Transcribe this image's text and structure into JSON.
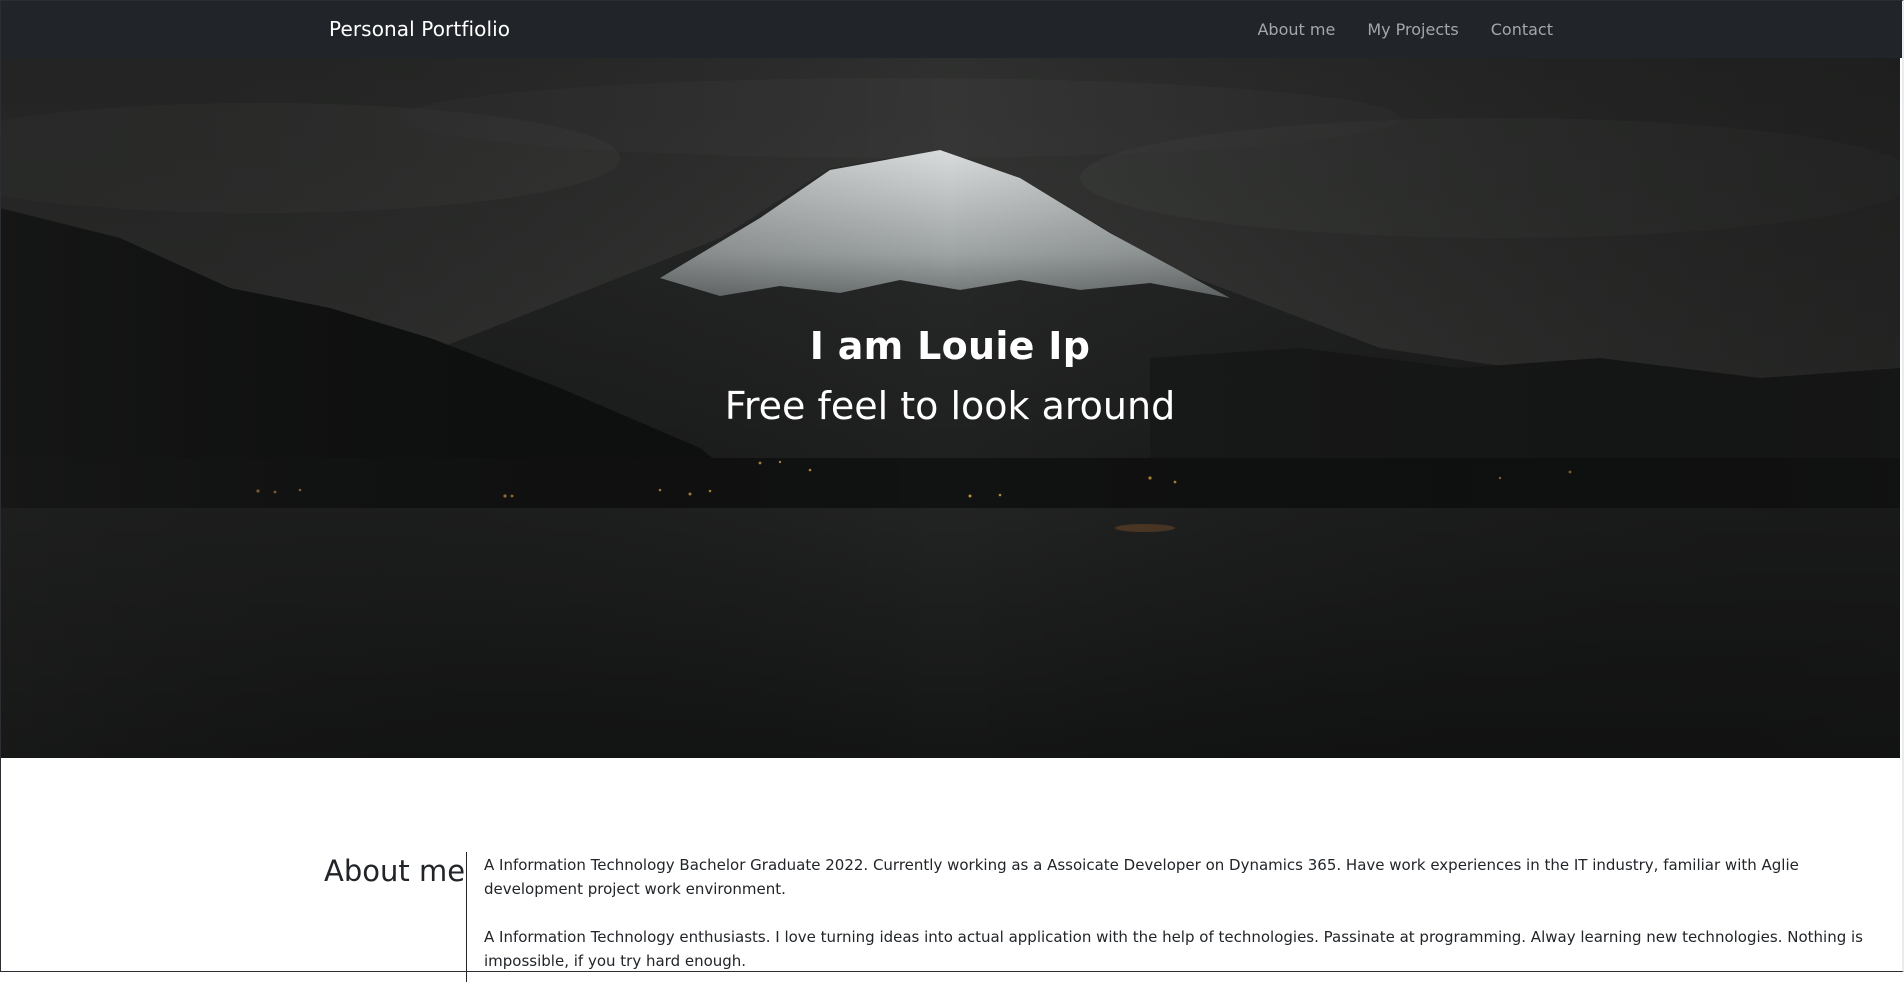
{
  "navbar": {
    "brand": "Personal Portfiolio",
    "links": [
      {
        "label": "About me"
      },
      {
        "label": "My Projects"
      },
      {
        "label": "Contact"
      }
    ]
  },
  "hero": {
    "title": "I am Louie Ip",
    "subtitle": "Free feel to look around"
  },
  "about": {
    "heading": "About me",
    "paragraphs": [
      "A Information Technology Bachelor Graduate 2022. Currently working as a Assoicate Developer on Dynamics 365. Have work experiences in the IT industry, familiar with Aglie development project work environment.",
      "A Information Technology enthusiasts. I love turning ideas into actual application with the help of technologies. Passinate at programming. Alway learning new technologies. Nothing is impossible, if you try hard enough."
    ]
  },
  "colors": {
    "navbar_bg": "#212529",
    "nav_link": "#a3a7ab",
    "text_dark": "#212529"
  }
}
